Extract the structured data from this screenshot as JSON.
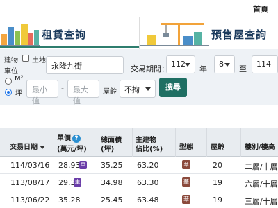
{
  "topbar": {
    "home_label": "首頁"
  },
  "tabs": [
    {
      "label": "租賃查詢"
    },
    {
      "label": "預售屋查詢"
    }
  ],
  "filters": {
    "building_label": "建物",
    "land_label": "土地",
    "unit_label": "車位",
    "road_value": "永隆九街",
    "period_label": "交易期間：",
    "year_from": "112",
    "month_from": "8",
    "year_unit": "年",
    "to_label": "至",
    "year_to": "114",
    "area_unit_m2": "M²",
    "area_unit_ping": "坪",
    "min_placeholder": "最小值",
    "max_placeholder": "最大值",
    "dash": "-",
    "age_label": "屋齡",
    "age_value": "不拘",
    "search_button": "搜尋"
  },
  "table": {
    "headers": {
      "date": "交易日期",
      "unit_price_l1": "單價",
      "unit_price_l2": "(萬元/坪)",
      "total_area_l1": "總面積",
      "total_area_l2": "(坪)",
      "main_ratio_l1": "主建物",
      "main_ratio_l2": "佔比(%)",
      "type": "型態",
      "age": "屋齡",
      "floor": "樓別/樓高"
    },
    "rows": [
      {
        "date": "114/03/16",
        "price": "28.93",
        "price_badge": "車",
        "area": "35.25",
        "ratio": "63.20",
        "type": "華",
        "age": "20",
        "floor": "二層/十層"
      },
      {
        "date": "113/08/17",
        "price": "29.3",
        "price_badge": "車",
        "area": "34.98",
        "ratio": "63.30",
        "type": "華",
        "age": "19",
        "floor": "六層/十層"
      },
      {
        "date": "113/06/22",
        "price": "35.28",
        "price_badge": "",
        "area": "25.45",
        "ratio": "63.48",
        "type": "華",
        "age": "19",
        "floor": "三層/十層"
      }
    ]
  },
  "colors": {
    "accent": "#1f6f63",
    "header_bg": "#e8ecf0",
    "badge_parking": "#6a3da8",
    "badge_type": "#8b4a3c"
  }
}
